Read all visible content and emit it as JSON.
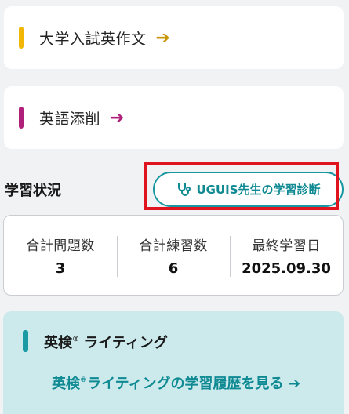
{
  "cards": [
    {
      "label": "大学入試英作文",
      "arrow": "➔",
      "bar_color": "#f2b705",
      "arrow_color": "#c9960c"
    },
    {
      "label": "英語添削",
      "arrow": "➔",
      "bar_color": "#b0207a",
      "arrow_color": "#b0207a"
    }
  ],
  "status": {
    "title": "学習状況",
    "diagnosis_button": "UGUIS先生の学習診断",
    "icon": "stethoscope-icon",
    "highlight_color": "#e0141e"
  },
  "stats": [
    {
      "label": "合計問題数",
      "value": "3"
    },
    {
      "label": "合計練習数",
      "value": "6"
    },
    {
      "label": "最終学習日",
      "value": "2025.09.30"
    }
  ],
  "eiken": {
    "title_main": "英検",
    "title_mark": "®",
    "title_rest": " ライティング",
    "link_main": "英検",
    "link_mark": "®",
    "link_rest": "ライティングの学習履歴を見る ➔",
    "accent": "#1a9aa2"
  }
}
